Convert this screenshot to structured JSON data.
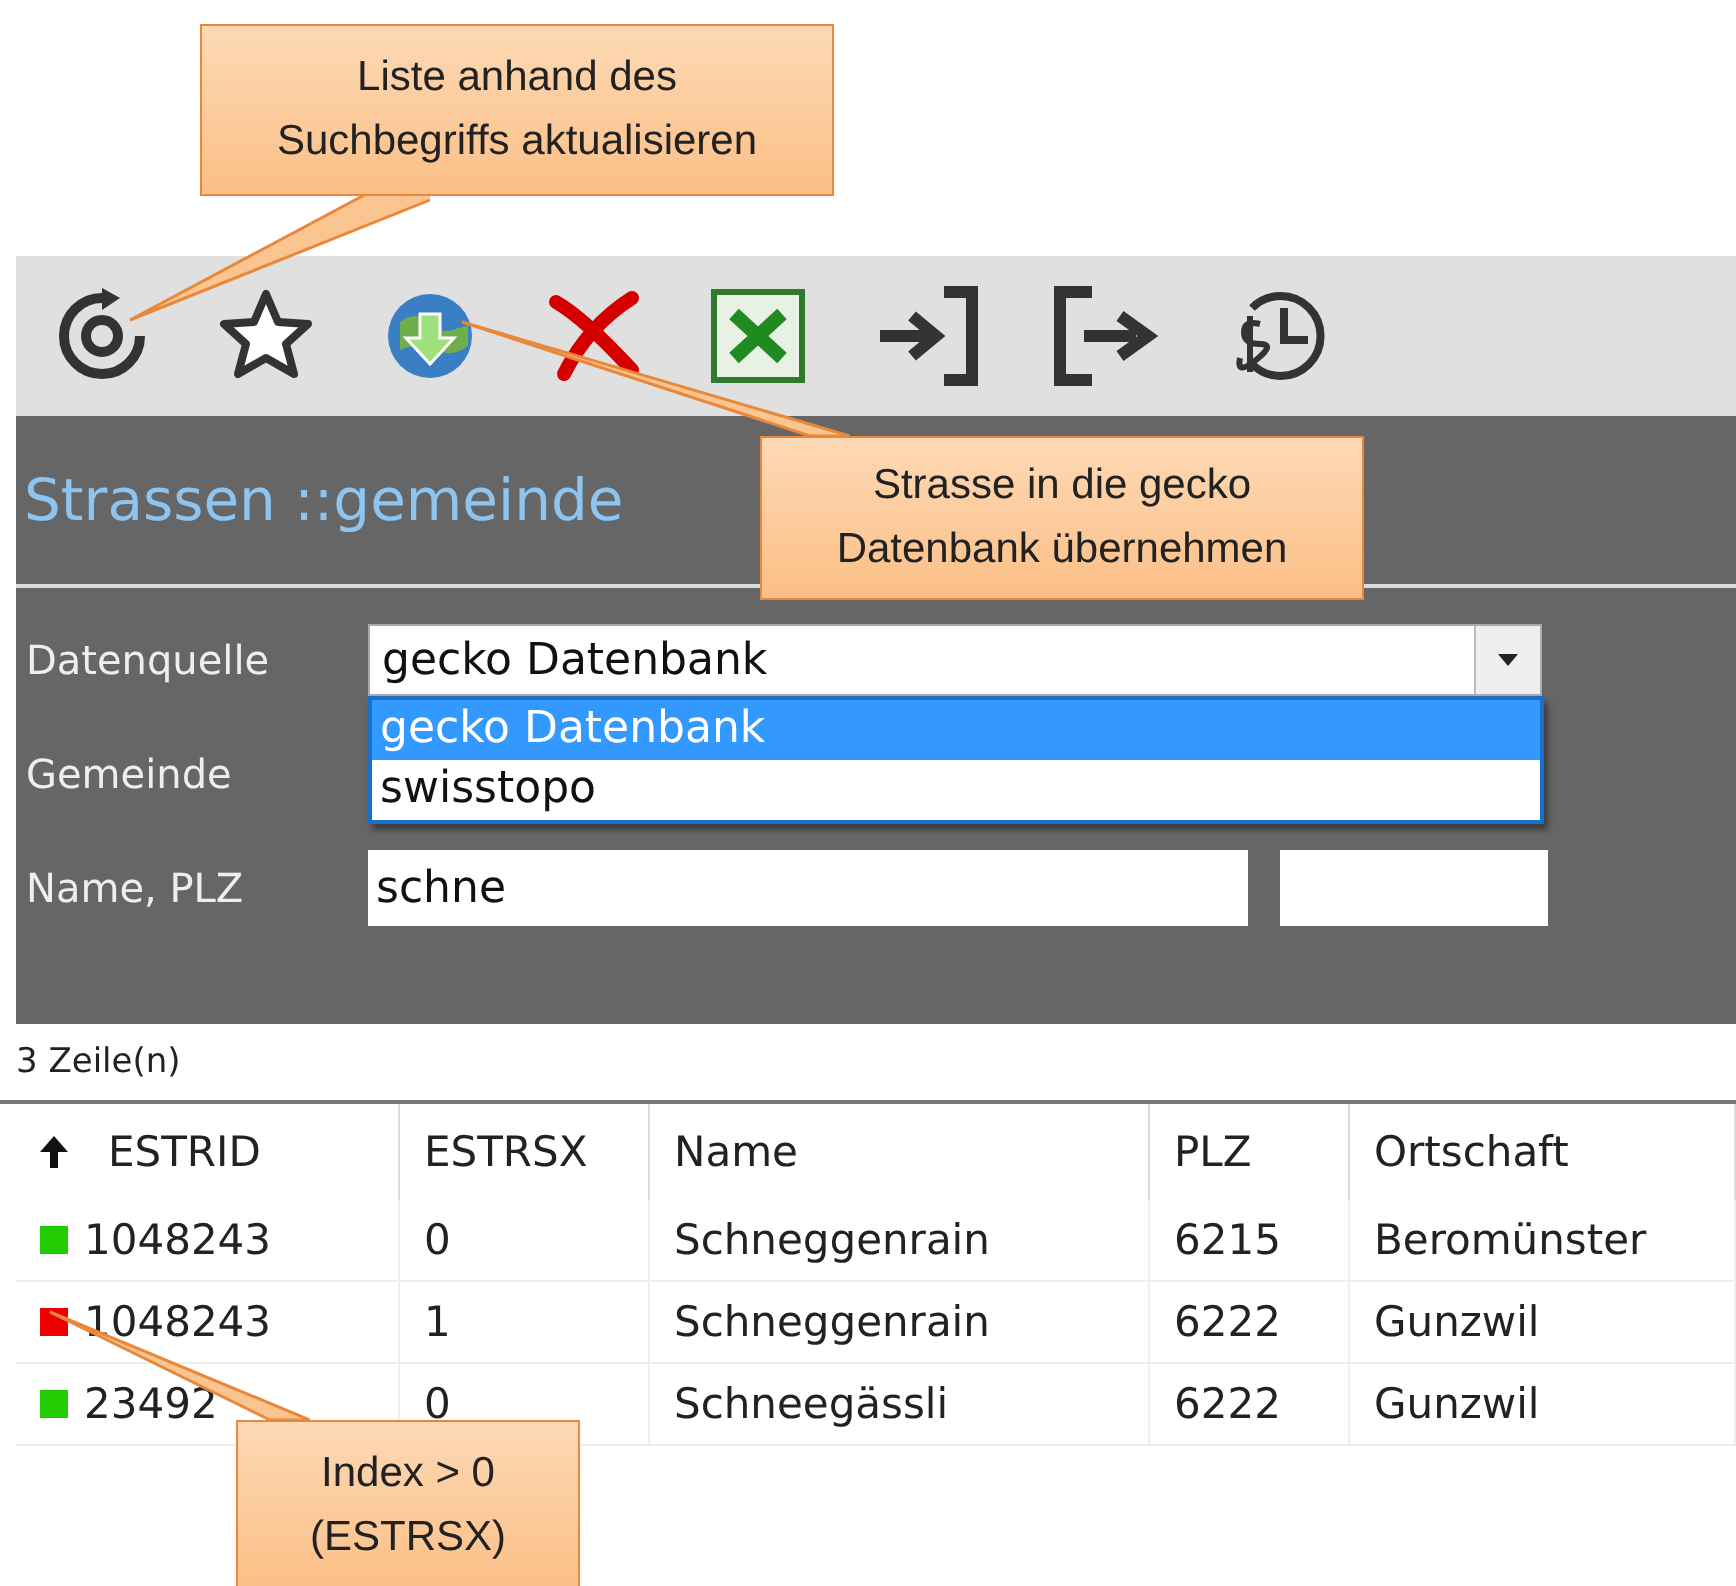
{
  "callouts": [
    {
      "lines": [
        "Liste anhand des",
        "Suchbegriffs aktualisieren"
      ]
    },
    {
      "lines": [
        "Strasse in die gecko",
        "Datenbank übernehmen"
      ]
    },
    {
      "lines": [
        "Index > 0",
        "(ESTRSX)"
      ]
    }
  ],
  "title": "Strassen ::gemeinde",
  "form": {
    "fields": [
      {
        "kind": "combo",
        "label": "Datenquelle",
        "value": "gecko Datenbank",
        "expanded": true,
        "options": [
          {
            "label": "gecko Datenbank",
            "selected": true
          },
          {
            "label": "swisstopo",
            "selected": false
          }
        ]
      },
      {
        "kind": "hidden",
        "label": "Gemeinde"
      },
      {
        "kind": "pair",
        "label": "Name, PLZ",
        "value": "schne"
      }
    ]
  },
  "table": {
    "status": "3 Zeile(n)",
    "columns": [
      {
        "label": "ESTRID",
        "sorted": true
      },
      {
        "label": "ESTRSX",
        "sorted": false
      },
      {
        "label": "Name",
        "sorted": false
      },
      {
        "label": "PLZ",
        "sorted": false
      },
      {
        "label": "Ortschaft",
        "sorted": false
      }
    ],
    "rows": [
      {
        "color": "#22cc00",
        "cells": [
          "1048243",
          "0",
          "Schneggenrain",
          "6215",
          "Beromünster"
        ]
      },
      {
        "color": "#ee0000",
        "cells": [
          "1048243",
          "1",
          "Schneggenrain",
          "6222",
          "Gunzwil"
        ]
      },
      {
        "color": "#22cc00",
        "cells": [
          "23492",
          "0",
          "Schneegässli",
          "6222",
          "Gunzwil"
        ]
      }
    ]
  }
}
